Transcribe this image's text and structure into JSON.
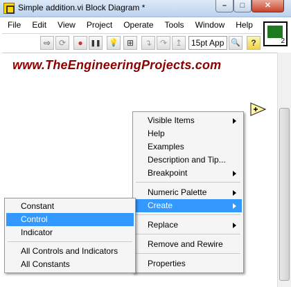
{
  "window": {
    "title": "Simple addition.vi Block Diagram *",
    "minimize": "–",
    "maximize": "□",
    "close": "✕"
  },
  "menubar": {
    "items": [
      "File",
      "Edit",
      "View",
      "Project",
      "Operate",
      "Tools",
      "Window",
      "Help"
    ]
  },
  "toolbar": {
    "font_select": "15pt App",
    "icons": [
      "run-arrow-icon",
      "run-continuously-icon",
      "abort-icon",
      "pause-icon",
      "highlight-execution-icon",
      "retain-wire-values-icon",
      "step-into-icon",
      "step-over-icon",
      "step-out-icon",
      "font-select",
      "zoom-icon",
      "help-icon"
    ],
    "glyphs": {
      "run": "⇨",
      "run_cont": "⟳",
      "abort": "●",
      "pause": "❚❚",
      "highlight": "💡",
      "retain": "⊞",
      "step_into": "↴",
      "step_over": "↷",
      "step_out": "↥",
      "zoom": "🔍",
      "help": "?"
    }
  },
  "vi_icon": {
    "number": "2"
  },
  "watermark": "www.TheEngineeringProjects.com",
  "context_menu": {
    "items": [
      {
        "label": "Visible Items",
        "submenu": true
      },
      {
        "label": "Help",
        "submenu": false
      },
      {
        "label": "Examples",
        "submenu": false
      },
      {
        "label": "Description and Tip...",
        "submenu": false
      },
      {
        "label": "Breakpoint",
        "submenu": true
      },
      {
        "label": "Numeric Palette",
        "submenu": true
      },
      {
        "label": "Create",
        "submenu": true,
        "highlighted": true
      },
      {
        "label": "Replace",
        "submenu": true
      },
      {
        "label": "Remove and Rewire",
        "submenu": false
      },
      {
        "label": "Properties",
        "submenu": false
      }
    ]
  },
  "create_submenu": {
    "items": [
      {
        "label": "Constant"
      },
      {
        "label": "Control",
        "highlighted": true
      },
      {
        "label": "Indicator"
      },
      {
        "label": "All Controls and Indicators"
      },
      {
        "label": "All Constants"
      }
    ]
  },
  "colors": {
    "highlight": "#3399ff",
    "watermark": "#8b0000"
  }
}
